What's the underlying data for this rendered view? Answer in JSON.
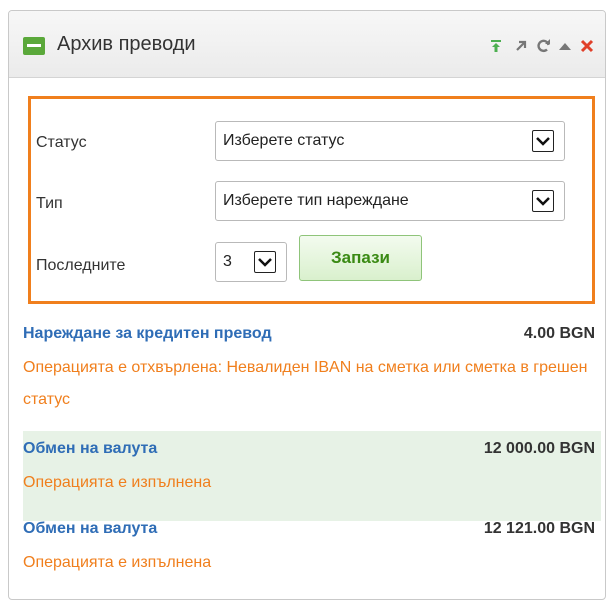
{
  "widget": {
    "title": "Архив преводи",
    "icons": [
      "panel-top-icon",
      "popout-icon",
      "refresh-icon",
      "collapse-icon",
      "close-icon"
    ]
  },
  "filters": {
    "status_label": "Статус",
    "status_value": "Изберете статус",
    "type_label": "Тип",
    "type_value": "Изберете тип нареждане",
    "last_label": "Последните",
    "last_value": "3",
    "save_label": "Запази"
  },
  "transactions": [
    {
      "title": "Нареждане за кредитен превод",
      "amount": "4.00 BGN",
      "status": "Операцията е отхвърлена: Невалиден IBAN на сметка или сметка в грешен статус"
    },
    {
      "title": "Обмен на валута",
      "amount": "12 000.00 BGN",
      "status": "Операцията е изпълнена"
    },
    {
      "title": "Обмен на валута",
      "amount": "12 121.00 BGN",
      "status": "Операцията е изпълнена"
    }
  ],
  "colors": {
    "accent_orange": "#f07f1d",
    "link_blue": "#2f6db6",
    "button_green": "#3a8a14",
    "row_highlight": "#e7f2e6"
  }
}
